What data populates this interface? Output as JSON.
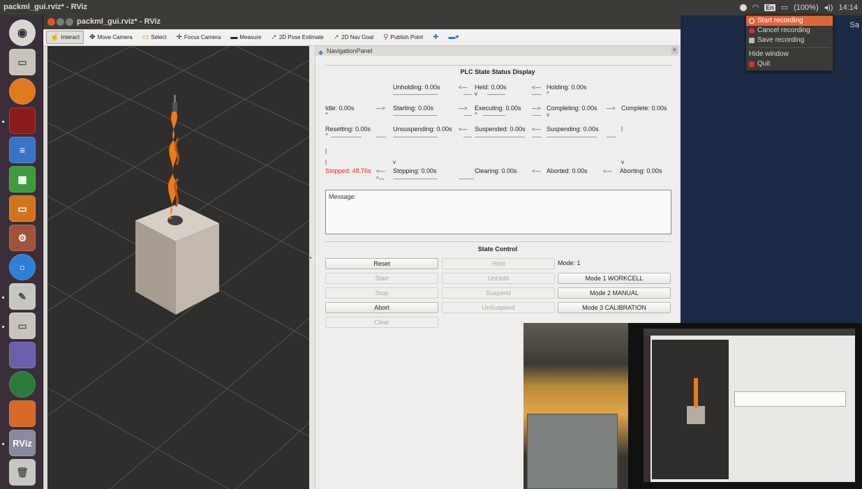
{
  "system": {
    "window_title": "packml_gui.rviz* - RViz",
    "lang_badge": "En",
    "battery": "(100%)",
    "volume_glyph": "◂))",
    "clock": "14:14",
    "desktop_text": "Sa"
  },
  "rviz": {
    "title": "packml_gui.rviz* - RViz",
    "toolbar": [
      {
        "label": "Interact",
        "icon": "hand-icon"
      },
      {
        "label": "Move Camera",
        "icon": "move-camera-icon"
      },
      {
        "label": "Select",
        "icon": "select-icon"
      },
      {
        "label": "Focus Camera",
        "icon": "focus-camera-icon"
      },
      {
        "label": "Measure",
        "icon": "ruler-icon"
      },
      {
        "label": "2D Pose Estimate",
        "icon": "pose-arrow-icon"
      },
      {
        "label": "2D Nav Goal",
        "icon": "nav-goal-icon"
      },
      {
        "label": "Publish Point",
        "icon": "pin-icon"
      }
    ]
  },
  "panel": {
    "header": "NavigationPanel",
    "state_title": "PLC State Status Display",
    "states": {
      "unholding": "Unholding: 0.00s",
      "held": "Held: 0.00s",
      "holding": "Holding: 0.00s",
      "idle": "Idle: 0.00s",
      "starting": "Starting: 0.00s",
      "executing": "Executing: 0.00s",
      "completing": "Completing: 0.00s",
      "complete": "Complete: 0.00s",
      "resetting": "Resetting: 0.00s",
      "unsuspending": "Unsuspending: 0.00s",
      "suspended": "Suspended: 0.00s",
      "suspending": "Suspending: 0.00s",
      "stopped": "Stopped: 48.76s",
      "stopping": "Stopping: 0.00s",
      "clearing": "Clearing: 0.00s",
      "aborted": "Aborted: 0.00s",
      "aborting": "Aborting: 0.00s"
    },
    "arrows": {
      "right": "—>",
      "left": "<—",
      "up": "^",
      "down": "v",
      "bar": "|",
      "back_arrow": "^—"
    },
    "message_label": "Message:",
    "control_title": "State Control",
    "buttons": {
      "reset": "Reset",
      "hold": "Hold",
      "start": "Start",
      "unhold": "UnHold",
      "stop": "Stop",
      "suspend": "Suspend",
      "abort": "Abort",
      "unsuspend": "UnSuspend",
      "clear": "Clear",
      "mode1": "Mode 1 WORKCELL",
      "mode2": "Mode 2 MANUAL",
      "mode3": "Mode 3 CALIBRATION"
    },
    "mode_label": "Mode: 1"
  },
  "recording_menu": {
    "items": [
      {
        "label": "Start recording",
        "icon": "record-icon",
        "color": "#e0663a"
      },
      {
        "label": "Cancel recording",
        "icon": "cancel-icon",
        "color": "#d9302a"
      },
      {
        "label": "Save recording",
        "icon": "save-icon",
        "color": "#bcbab5"
      },
      {
        "label": "Hide window",
        "icon": "",
        "color": ""
      },
      {
        "label": "Quit",
        "icon": "quit-icon",
        "color": "#d9302a"
      }
    ]
  },
  "launcher": {
    "rviz_label": "RViz"
  },
  "colors": {
    "accent": "#e0663a",
    "stopped_red": "#d92b2b",
    "robot_orange": "#ef7a1a"
  }
}
